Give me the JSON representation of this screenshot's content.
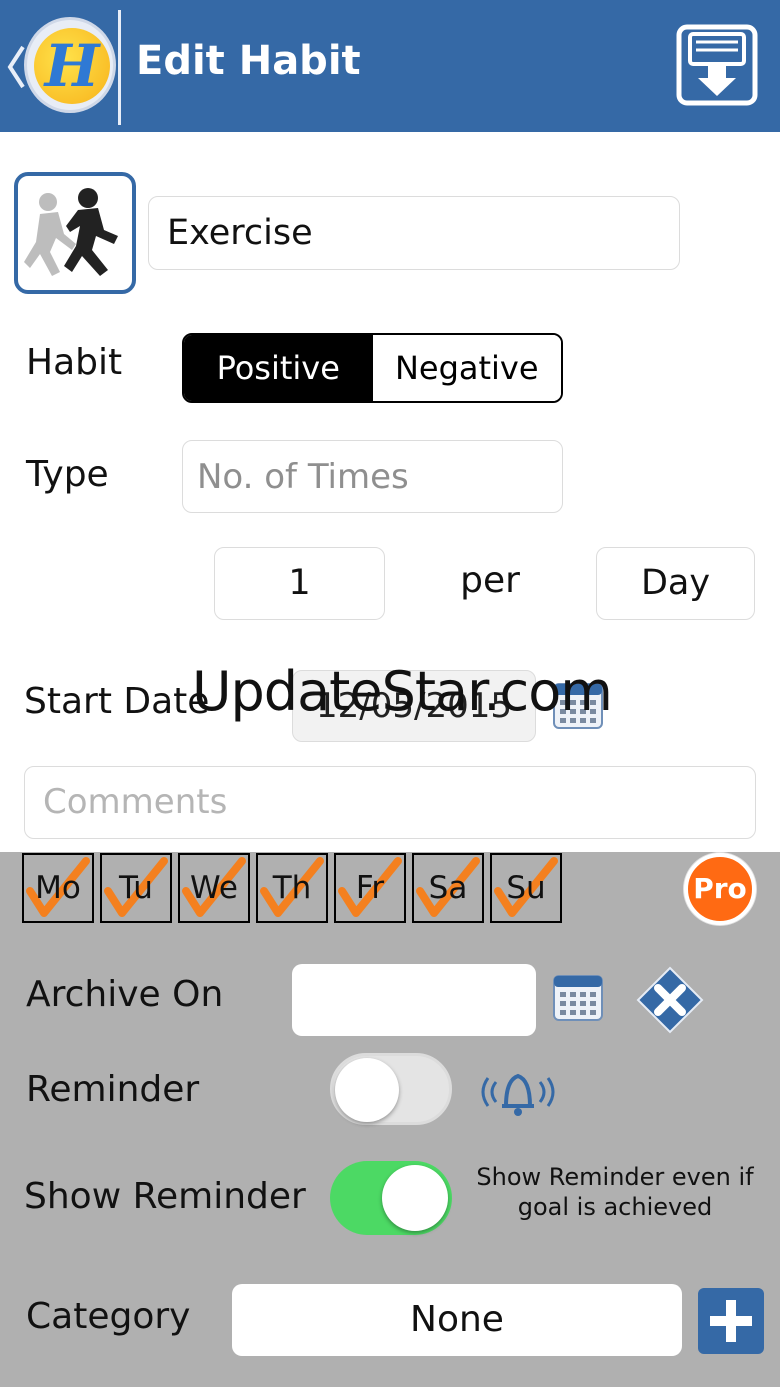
{
  "header": {
    "title": "Edit Habit",
    "logo_glyph": "H",
    "back_icon": "chevron-left-icon",
    "save_icon": "save-download-icon",
    "color": "#3569a6"
  },
  "habit": {
    "icon": "running-person-icon",
    "name": "Exercise"
  },
  "habit_type": {
    "label": "Habit",
    "options": [
      "Positive",
      "Negative"
    ],
    "selected": "Positive"
  },
  "type": {
    "label": "Type",
    "placeholder": "No. of Times"
  },
  "frequency": {
    "count": "1",
    "per_label": "per",
    "period": "Day"
  },
  "start_date": {
    "label": "Start Date",
    "value": "12/05/2015"
  },
  "watermark": "UpdateStar.com",
  "comments": {
    "placeholder": "Comments"
  },
  "days": [
    {
      "label": "Mo",
      "checked": true
    },
    {
      "label": "Tu",
      "checked": true
    },
    {
      "label": "We",
      "checked": true
    },
    {
      "label": "Th",
      "checked": true
    },
    {
      "label": "Fr",
      "checked": true
    },
    {
      "label": "Sa",
      "checked": true
    },
    {
      "label": "Su",
      "checked": true
    }
  ],
  "pro_badge": "Pro",
  "archive": {
    "label": "Archive On",
    "value": ""
  },
  "reminder": {
    "label": "Reminder",
    "enabled": false
  },
  "show_reminder": {
    "label": "Show Reminder",
    "enabled": true,
    "hint": "Show Reminder even if goal is achieved"
  },
  "category": {
    "label": "Category",
    "value": "None"
  },
  "colors": {
    "accent": "#3569a6",
    "check": "#f4801f",
    "pro": "#ff6a13",
    "toggle_on": "#4cd964",
    "panel": "#b0b0b0"
  }
}
